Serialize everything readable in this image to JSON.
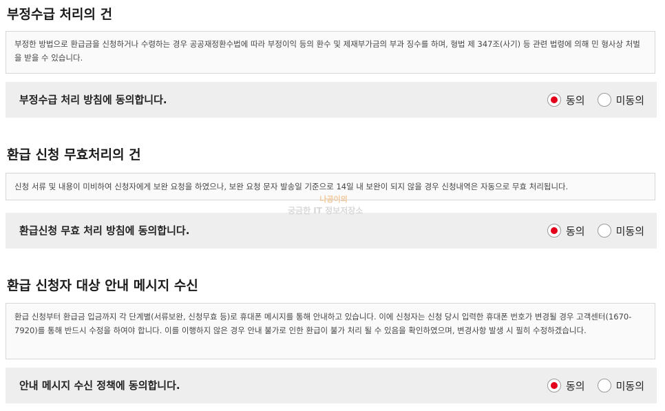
{
  "sections": [
    {
      "title": "부정수급 처리의 건",
      "notice": "부정한 방법으로 환급금을 신청하거나 수령하는 경우 공공재정환수법에 따라 부정이익 등의 환수 및 제재부가금의 부과 징수를 하며, 형법 제 347조(사기) 등 관련 법령에 의해 민 형사상 처벌을 받을 수 있습니다.",
      "agree_text": "부정수급 처리 방침에 동의합니다.",
      "options": {
        "agree": "동의",
        "disagree": "미동의"
      },
      "selected": "agree"
    },
    {
      "title": "환급 신청 무효처리의 건",
      "notice": "신청 서류 및 내용이 미비하여 신청자에게 보완 요청을 하였으나, 보완 요청 문자 발송일 기준으로 14일 내 보완이 되지 않을 경우 신청내역은 자동으로 무효 처리됩니다.",
      "agree_text": "환급신청 무효 처리 방침에 동의합니다.",
      "options": {
        "agree": "동의",
        "disagree": "미동의"
      },
      "selected": "agree"
    },
    {
      "title": "환급 신청자 대상 안내 메시지 수신",
      "notice": "환급 신청부터 환급금 입금까지 각 단계별(서류보완, 신청무효 등)로 휴대폰 메시지를 통해 안내하고 있습니다. 이에 신청자는 신청 당시 입력한 휴대폰 번호가 변경될 경우 고객센터(1670-7920)를 통해 반드시 수정을 하여야 합니다. 이를 이행하지 않은 경우 안내 불가로 인한 환급이 불가 처리 될 수 있음을 확인하였으며, 변경사항 발생 시 필히 수정하겠습니다.",
      "agree_text": "안내 메시지 수신 정책에 동의합니다.",
      "options": {
        "agree": "동의",
        "disagree": "미동의"
      },
      "selected": "agree"
    }
  ],
  "watermark": {
    "top": "나공이의",
    "bottom": "궁금한 IT 정보저장소"
  },
  "colors": {
    "radio_checked": "#e4001a",
    "bar_bg": "#eeeeee",
    "box_border": "#d6d6d6"
  }
}
